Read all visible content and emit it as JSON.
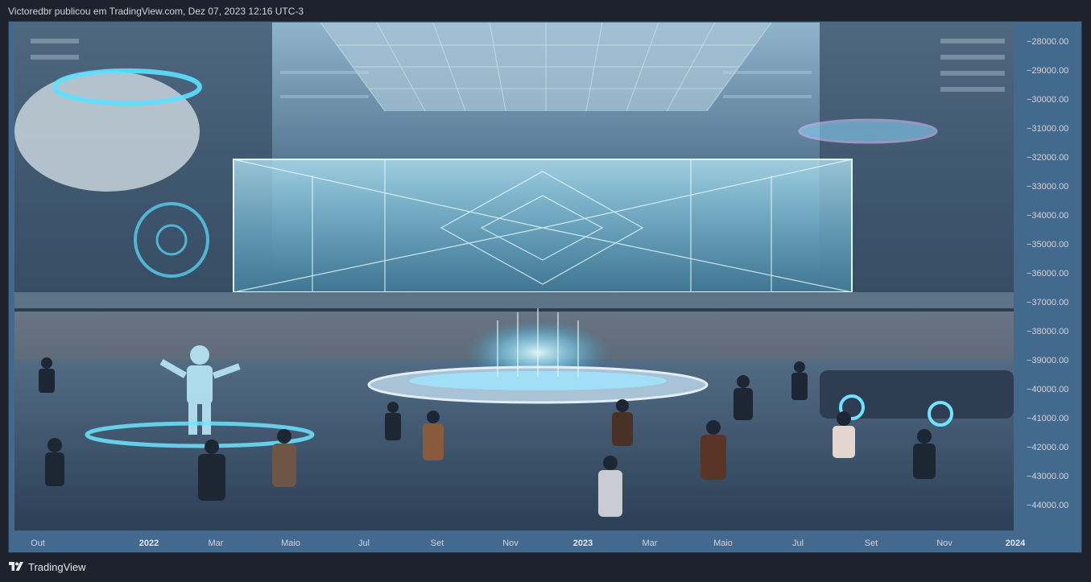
{
  "header": {
    "caption": "Victoredbr publicou em TradingView.com, Dez 07, 2023 12:16 UTC-3"
  },
  "picture": {
    "description_icon": "futuristic-plaza-illustration"
  },
  "y_axis": {
    "labels": [
      "28000.00",
      "29000.00",
      "30000.00",
      "31000.00",
      "32000.00",
      "33000.00",
      "34000.00",
      "35000.00",
      "36000.00",
      "37000.00",
      "38000.00",
      "39000.00",
      "40000.00",
      "41000.00",
      "42000.00",
      "43000.00",
      "44000.00"
    ]
  },
  "x_axis": {
    "labels": [
      {
        "text": "Out",
        "strong": false
      },
      {
        "text": "2022",
        "strong": true
      },
      {
        "text": "Mar",
        "strong": false
      },
      {
        "text": "Maio",
        "strong": false
      },
      {
        "text": "Jul",
        "strong": false
      },
      {
        "text": "Set",
        "strong": false
      },
      {
        "text": "Nov",
        "strong": false
      },
      {
        "text": "2023",
        "strong": true
      },
      {
        "text": "Mar",
        "strong": false
      },
      {
        "text": "Maio",
        "strong": false
      },
      {
        "text": "Jul",
        "strong": false
      },
      {
        "text": "Set",
        "strong": false
      },
      {
        "text": "Nov",
        "strong": false
      },
      {
        "text": "2024",
        "strong": true
      }
    ]
  },
  "footer": {
    "brand": "TradingView",
    "logo_icon": "tradingview-logo-icon"
  },
  "colors": {
    "background": "#1e222d",
    "chart_background": "#44698f",
    "text": "#d1d4dc"
  }
}
